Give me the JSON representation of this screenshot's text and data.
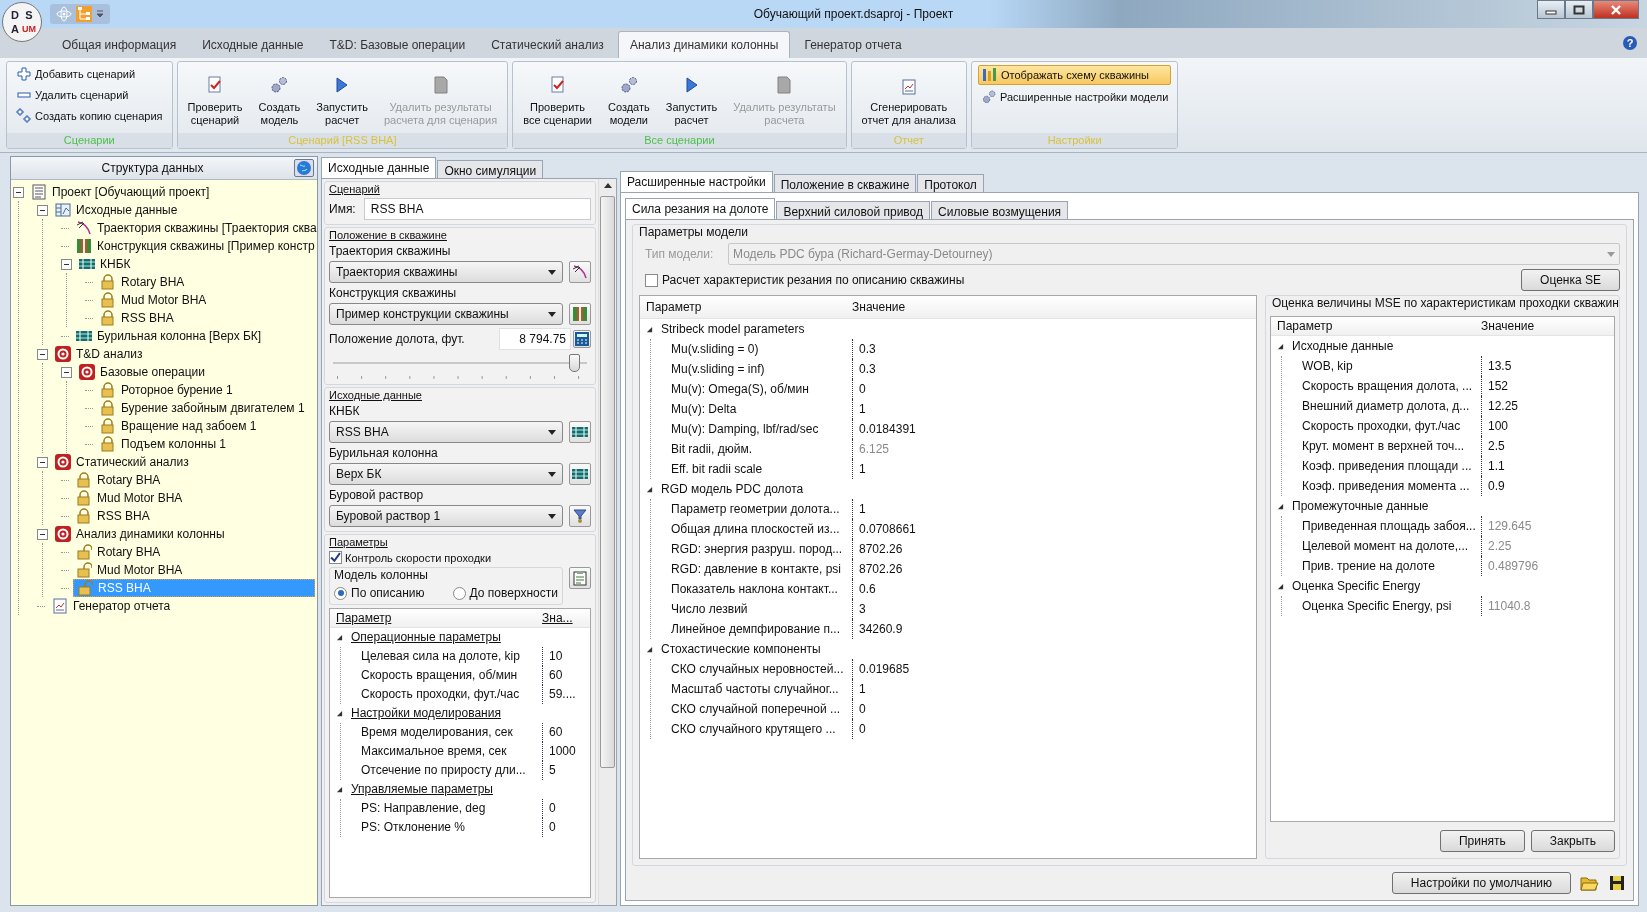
{
  "window": {
    "title": "Обучающий проект.dsaproj - Проект",
    "logo_letters": [
      "D",
      "S",
      "A",
      "UM"
    ],
    "help_glyph": "?"
  },
  "ribbon": {
    "tabs": [
      {
        "label": "Общая информация",
        "selected": false
      },
      {
        "label": "Исходные данные",
        "selected": false
      },
      {
        "label": "T&D: Базовые операции",
        "selected": false
      },
      {
        "label": "Статический анализ",
        "selected": false
      },
      {
        "label": "Анализ динамики колонны",
        "selected": true
      },
      {
        "label": "Генератор отчета",
        "selected": false
      }
    ],
    "groups": [
      {
        "label": "Сценарии",
        "color": "#4cc04c",
        "kind": "list",
        "items": [
          {
            "label": "Добавить сценарий",
            "kind": "add",
            "disabled": false,
            "on": false
          },
          {
            "label": "Удалить сценарий",
            "kind": "remove",
            "disabled": false,
            "on": false
          },
          {
            "label": "Создать копию сценария",
            "kind": "copy",
            "disabled": false,
            "on": false
          }
        ]
      },
      {
        "label": "Сценарий [RSS BHA]",
        "color": "#d8c23a",
        "kind": "buttons",
        "items": [
          {
            "label": "Проверить\nсценарий",
            "kind": "check",
            "disabled": false,
            "on": false
          },
          {
            "label": "Создать\nмодель",
            "kind": "create",
            "disabled": false,
            "on": false
          },
          {
            "label": "Запустить\nрасчет",
            "kind": "run",
            "disabled": false,
            "on": false
          },
          {
            "label": "Удалить результаты\nрасчета для сценария",
            "kind": "delete",
            "disabled": true,
            "on": false
          }
        ]
      },
      {
        "label": "Все сценарии",
        "color": "#4cc04c",
        "kind": "buttons",
        "items": [
          {
            "label": "Проверить\nвсе сценарии",
            "kind": "check",
            "disabled": false,
            "on": false
          },
          {
            "label": "Создать\nмодели",
            "kind": "create",
            "disabled": false,
            "on": false
          },
          {
            "label": "Запустить\nрасчет",
            "kind": "run",
            "disabled": false,
            "on": false
          },
          {
            "label": "Удалить результаты\nрасчета",
            "kind": "delete",
            "disabled": true,
            "on": false
          }
        ]
      },
      {
        "label": "Отчет",
        "color": "#d8c23a",
        "kind": "buttons",
        "items": [
          {
            "label": "Сгенерировать\nотчет для анализа",
            "kind": "report",
            "disabled": false,
            "on": false
          }
        ]
      },
      {
        "label": "Настройки",
        "color": "#d8c23a",
        "kind": "list",
        "items": [
          {
            "label": "Отображать схему скважины",
            "kind": "scheme",
            "disabled": false,
            "on": true
          },
          {
            "label": "Расширенные настройки модели",
            "kind": "settings",
            "disabled": false,
            "on": false
          }
        ]
      }
    ]
  },
  "structure": {
    "title": "Структура данных",
    "tree": [
      {
        "label": "Проект [Обучающий проект]",
        "kind": "project",
        "selected": false,
        "expanded": true,
        "children": [
          {
            "label": "Исходные данные",
            "kind": "data",
            "selected": false,
            "expanded": true,
            "children": [
              {
                "label": "Траектория скважины [Траектория сква",
                "kind": "trajectory",
                "selected": false
              },
              {
                "label": "Конструкция скважины [Пример констр",
                "kind": "construction",
                "selected": false
              },
              {
                "label": "КНБК",
                "kind": "bha",
                "selected": false,
                "expanded": true,
                "children": [
                  {
                    "label": "Rotary BHA",
                    "kind": "lock",
                    "selected": false
                  },
                  {
                    "label": "Mud Motor BHA",
                    "kind": "lock",
                    "selected": false
                  },
                  {
                    "label": "RSS BHA",
                    "kind": "lock",
                    "selected": false
                  }
                ]
              },
              {
                "label": "Бурильная колонна [Верх БК]",
                "kind": "bha",
                "selected": false
              }
            ]
          },
          {
            "label": "T&D анализ",
            "kind": "target",
            "selected": false,
            "expanded": true,
            "children": [
              {
                "label": "Базовые операции",
                "kind": "target",
                "selected": false,
                "expanded": true,
                "children": [
                  {
                    "label": "Роторное бурение 1",
                    "kind": "lock",
                    "selected": false
                  },
                  {
                    "label": "Бурение забойным двигателем 1",
                    "kind": "lock",
                    "selected": false
                  },
                  {
                    "label": "Вращение над забоем 1",
                    "kind": "lock",
                    "selected": false
                  },
                  {
                    "label": "Подъем колонны 1",
                    "kind": "lock",
                    "selected": false
                  }
                ]
              }
            ]
          },
          {
            "label": "Статический анализ",
            "kind": "target",
            "selected": false,
            "expanded": true,
            "children": [
              {
                "label": "Rotary BHA",
                "kind": "lock",
                "selected": false
              },
              {
                "label": "Mud Motor BHA",
                "kind": "lock",
                "selected": false
              },
              {
                "label": "RSS BHA",
                "kind": "lock",
                "selected": false
              }
            ]
          },
          {
            "label": "Анализ динамики колонны",
            "kind": "target",
            "selected": false,
            "expanded": true,
            "children": [
              {
                "label": "Rotary BHA",
                "kind": "unlock",
                "selected": false
              },
              {
                "label": "Mud Motor BHA",
                "kind": "unlock",
                "selected": false
              },
              {
                "label": "RSS BHA",
                "kind": "unlock",
                "selected": true
              }
            ]
          },
          {
            "label": "Генератор отчета",
            "kind": "report",
            "selected": false
          }
        ]
      }
    ]
  },
  "scenario_panel": {
    "tabs": [
      {
        "label": "Исходные данные",
        "selected": true
      },
      {
        "label": "Окно симуляции",
        "selected": false
      }
    ],
    "scenario": {
      "legend": "Сценарий",
      "name_label": "Имя:",
      "name_value": "RSS BHA"
    },
    "position": {
      "legend": "Положение в скважине",
      "fields": [
        {
          "label": "Траектория скважины",
          "value": "Траектория скважины",
          "kind": "trajectory"
        },
        {
          "label": "Конструкция скважины",
          "value": "Пример конструкции скважины",
          "kind": "construction"
        }
      ],
      "bit_label": "Положение долота, фут.",
      "bit_value": "8 794.75",
      "slider": {
        "level": 0.97
      }
    },
    "source": {
      "legend": "Исходные данные",
      "fields": [
        {
          "label": "КНБК",
          "value": "RSS BHA",
          "kind": "bha"
        },
        {
          "label": "Бурильная колонна",
          "value": "Верх БК",
          "kind": "bha"
        },
        {
          "label": "Буровой раствор",
          "value": "Буровой раствор 1",
          "kind": "fluid"
        }
      ]
    },
    "parameters": {
      "legend": "Параметры",
      "rop_control": {
        "label": "Контроль скорости проходки",
        "checked": true
      },
      "model": {
        "legend": "Модель колонны",
        "options": [
          {
            "label": "По описанию",
            "selected": true
          },
          {
            "label": "До поверхности",
            "selected": false
          }
        ]
      },
      "grid": {
        "columns": [
          "Параметр",
          "Зна..."
        ],
        "groups": [
          {
            "label": "Операционные параметры",
            "expanded": true,
            "rows": [
              {
                "name": "Целевая сила на долоте, kip",
                "value": "10",
                "readonly": false
              },
              {
                "name": "Скорость вращения, об/мин",
                "value": "60",
                "readonly": false
              },
              {
                "name": "Скорость проходки, фут./час",
                "value": "59....",
                "readonly": false
              }
            ]
          },
          {
            "label": "Настройки моделирования",
            "expanded": true,
            "rows": [
              {
                "name": "Время моделирования, сек",
                "value": "60",
                "readonly": false
              },
              {
                "name": "Максимальное время, сек",
                "value": "1000",
                "readonly": false
              },
              {
                "name": "Отсечение по приросту дли...",
                "value": "5",
                "readonly": false
              }
            ]
          },
          {
            "label": "Управляемые параметры",
            "expanded": true,
            "rows": [
              {
                "name": "PS: Направление, deg",
                "value": "0",
                "readonly": false
              },
              {
                "name": "PS: Отклонение %",
                "value": "0",
                "readonly": false
              }
            ]
          }
        ]
      }
    }
  },
  "settings": {
    "tabs": [
      {
        "label": "Расширенные настройки",
        "selected": true
      },
      {
        "label": "Положение в скважине",
        "selected": false
      },
      {
        "label": "Протокол",
        "selected": false
      }
    ],
    "subtabs": [
      {
        "label": "Сила резания на долоте",
        "selected": true
      },
      {
        "label": "Верхний силовой привод",
        "selected": false
      },
      {
        "label": "Силовые возмущения",
        "selected": false
      }
    ],
    "model": {
      "legend": "Параметры модели",
      "type_label": "Тип модели:",
      "type_value": "Модель PDC бура (Richard-Germay-Detourney)",
      "disabled": true,
      "calc": {
        "label": "Расчет характеристик резания по описанию скважины",
        "checked": false
      },
      "se_button": "Оценка SE"
    },
    "grid": {
      "columns": [
        "Параметр",
        "Значение"
      ],
      "groups": [
        {
          "label": "Stribeck model parameters",
          "expanded": true,
          "rows": [
            {
              "name": "Mu(v.sliding = 0)",
              "value": "0.3",
              "readonly": false
            },
            {
              "name": "Mu(v.sliding = inf)",
              "value": "0.3",
              "readonly": false
            },
            {
              "name": "Mu(v): Omega(S), об/мин",
              "value": "0",
              "readonly": false
            },
            {
              "name": "Mu(v): Delta",
              "value": "1",
              "readonly": false
            },
            {
              "name": "Mu(v): Damping, lbf/rad/sec",
              "value": "0.0184391",
              "readonly": false
            },
            {
              "name": "Bit radii, дюйм.",
              "value": "6.125",
              "readonly": true
            },
            {
              "name": "Eff. bit radii scale",
              "value": "1",
              "readonly": false
            }
          ]
        },
        {
          "label": "RGD модель PDC долота",
          "expanded": true,
          "rows": [
            {
              "name": "Параметр геометрии долота...",
              "value": "1",
              "readonly": false
            },
            {
              "name": "Общая длина плоскостей из...",
              "value": "0.0708661",
              "readonly": false
            },
            {
              "name": "RGD: энергия разруш. пород...",
              "value": "8702.26",
              "readonly": false
            },
            {
              "name": "RGD: давление в контакте, psi",
              "value": "8702.26",
              "readonly": false
            },
            {
              "name": "Показатель наклона контакт...",
              "value": "0.6",
              "readonly": false
            },
            {
              "name": "Число лезвий",
              "value": "3",
              "readonly": false
            },
            {
              "name": "Линейное демпфирование п...",
              "value": "34260.9",
              "readonly": false
            }
          ]
        },
        {
          "label": "Стохастические компоненты",
          "expanded": true,
          "rows": [
            {
              "name": "СКО случайных неровностей...",
              "value": "0.019685",
              "readonly": false
            },
            {
              "name": "Масштаб частоты случайног...",
              "value": "1",
              "readonly": false
            },
            {
              "name": "СКО случайной поперечной ...",
              "value": "0",
              "readonly": false
            },
            {
              "name": "СКО случайного крутящего ...",
              "value": "0",
              "readonly": false
            }
          ]
        }
      ]
    },
    "mse": {
      "legend": "Оценка величины MSE по характеристикам проходки скважин",
      "grid": {
        "columns": [
          "Параметр",
          "Значение"
        ],
        "groups": [
          {
            "label": "Исходные данные",
            "expanded": true,
            "rows": [
              {
                "name": "WOB, kip",
                "value": "13.5",
                "readonly": false
              },
              {
                "name": "Скорость вращения долота, ...",
                "value": "152",
                "readonly": false
              },
              {
                "name": "Внешний диаметр долота, д...",
                "value": "12.25",
                "readonly": false
              },
              {
                "name": "Скорость проходки, фут./час",
                "value": "100",
                "readonly": false
              },
              {
                "name": "Крут. момент в верхней точ...",
                "value": "2.5",
                "readonly": false
              },
              {
                "name": "Коэф. приведения площади ...",
                "value": "1.1",
                "readonly": false
              },
              {
                "name": "Коэф. приведения момента ...",
                "value": "0.9",
                "readonly": false
              }
            ]
          },
          {
            "label": "Промежуточные данные",
            "expanded": true,
            "rows": [
              {
                "name": "Приведенная площадь забоя...",
                "value": "129.645",
                "readonly": true
              },
              {
                "name": "Целевой момент на долоте,...",
                "value": "2.25",
                "readonly": true
              },
              {
                "name": "Прив. трение на долоте",
                "value": "0.489796",
                "readonly": true
              }
            ]
          },
          {
            "label": "Оценка Specific Energy",
            "expanded": true,
            "rows": [
              {
                "name": "Оценка Specific Energy, psi",
                "value": "11040.8",
                "readonly": true
              }
            ]
          }
        ]
      },
      "buttons": [
        "Принять",
        "Закрыть"
      ]
    },
    "default_button": "Настройки по умолчанию"
  }
}
